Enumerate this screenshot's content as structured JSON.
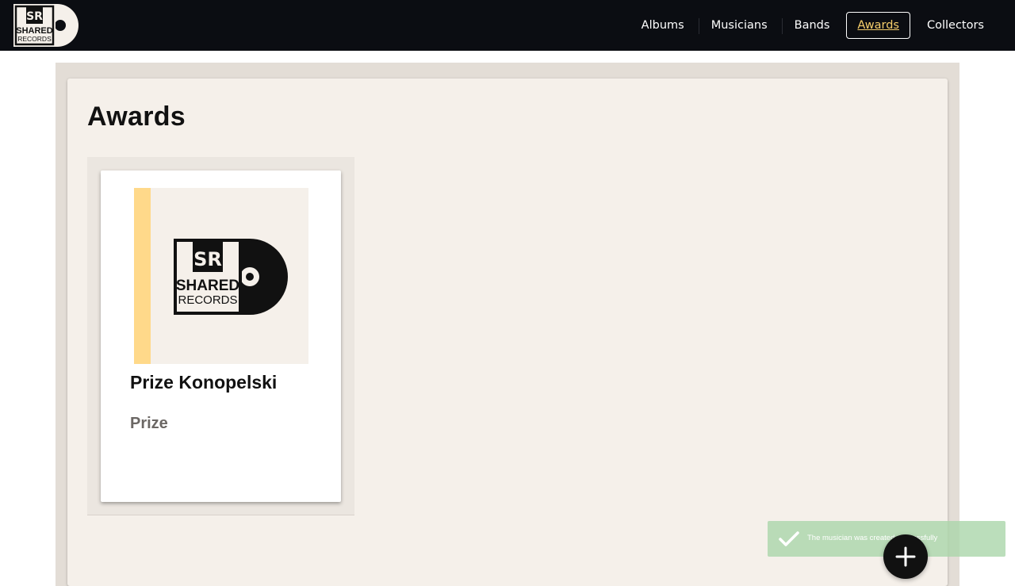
{
  "header": {
    "logo_text": "SR SHARED RECORDS",
    "nav": [
      {
        "label": "Albums",
        "active": false
      },
      {
        "label": "Musicians",
        "active": false
      },
      {
        "label": "Bands",
        "active": false
      },
      {
        "label": "Awards",
        "active": true
      },
      {
        "label": "Collectors",
        "active": false
      }
    ]
  },
  "main": {
    "title": "Awards",
    "cards": [
      {
        "title": "Prize Konopelski",
        "subtitle": "Prize",
        "image_icon": "shared-records-logo"
      }
    ]
  },
  "toast": {
    "icon": "check-icon",
    "message": "The musician was created successfully"
  },
  "fab": {
    "icon": "plus-icon"
  },
  "colors": {
    "navbar": "#0b0d12",
    "active_nav_text": "#f7cf6b",
    "panel": "#f5f0ea",
    "card_stripe": "#ffd98a",
    "toast": "#aad6aa"
  }
}
